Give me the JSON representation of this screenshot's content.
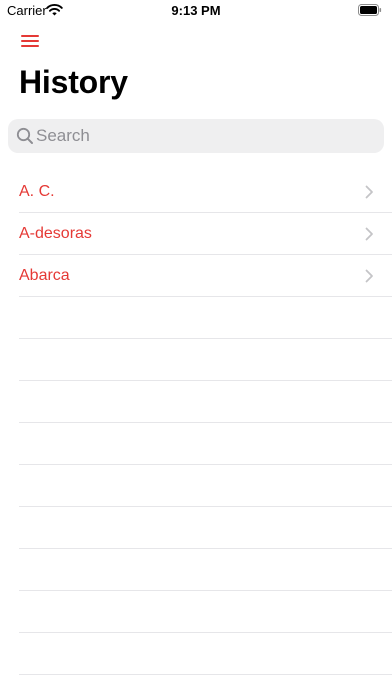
{
  "status_bar": {
    "carrier": "Carrier",
    "time": "9:13 PM"
  },
  "nav": {
    "menu_icon": "hamburger-menu-icon",
    "title": "History"
  },
  "search": {
    "placeholder": "Search",
    "value": ""
  },
  "history": {
    "items": [
      {
        "label": "A. C."
      },
      {
        "label": "A-desoras"
      },
      {
        "label": "Abarca"
      }
    ]
  },
  "colors": {
    "accent": "#e53935",
    "search_background": "#efeff0",
    "separator": "#e6e6e9"
  }
}
